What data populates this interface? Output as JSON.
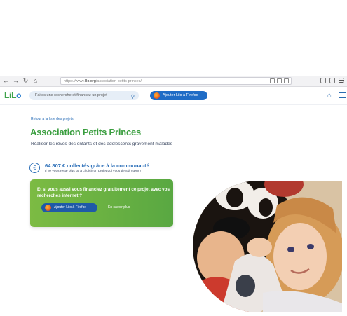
{
  "browser": {
    "url_prefix": "https://www.",
    "url_domain": "lilo.org",
    "url_path": "/association-petits-princes/"
  },
  "header": {
    "logo_text_1": "LiL",
    "logo_text_2": "o",
    "search_placeholder": "Faites une recherche et financez un projet",
    "firefox_button": "Ajouter Lilo à Firefox"
  },
  "main": {
    "back_link": "Retour à la liste des projets",
    "title": "Association Petits Princes",
    "subtitle": "Réaliser les rêves des enfants et des adolescents gravement malades",
    "amount": "64 807 € collectés grâce à la communauté",
    "amount_sub": "Il ne vous reste plus qu'à choisir un projet qui vous tient à cœur !",
    "card_text": "Et si vous aussi vous financiez gratuitement ce projet avec vos recherches internet ?",
    "card_button": "Ajouter Lilo à Firefox",
    "card_link": "En savoir plus"
  },
  "colors": {
    "brand_green": "#3a9e3f",
    "brand_blue": "#1f6cc6"
  }
}
